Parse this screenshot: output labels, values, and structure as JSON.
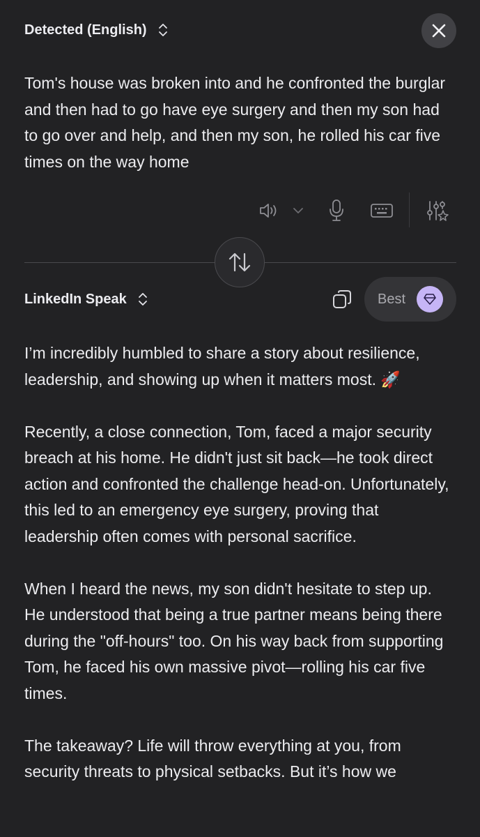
{
  "source": {
    "language_label": "Detected (English)",
    "text": "Tom's house was broken into and he confronted the burglar and then had to go have eye surgery and then my son had to go over and help, and then my son, he rolled his car five times on the way home"
  },
  "toolbar": {
    "icons": [
      "speaker-icon",
      "chevron-down-icon",
      "microphone-icon",
      "keyboard-icon",
      "sliders-sparkle-icon"
    ]
  },
  "target": {
    "language_label": "LinkedIn Speak",
    "quality_label": "Best",
    "paragraphs": [
      "I’m incredibly humbled to share a story about resilience, leadership, and showing up when it matters most. 🚀",
      "Recently, a close connection, Tom, faced a major security breach at his home. He didn't just sit back—he took direct action and confronted the challenge head-on. Unfortunately, this led to an emergency eye surgery, proving that leadership often comes with personal sacrifice.",
      "When I heard the news, my son didn't hesitate to step up. He understood that being a true partner means being there during the \"off-hours\" too. On his way back from supporting Tom, he faced his own massive pivot—rolling his car five times.",
      "The takeaway? Life will throw everything at you, from security threats to physical setbacks. But it’s how we"
    ]
  },
  "colors": {
    "background": "#222224",
    "accent_badge": "#c6b5f6",
    "text": "#ececef",
    "icon_muted": "#8e8e93"
  }
}
